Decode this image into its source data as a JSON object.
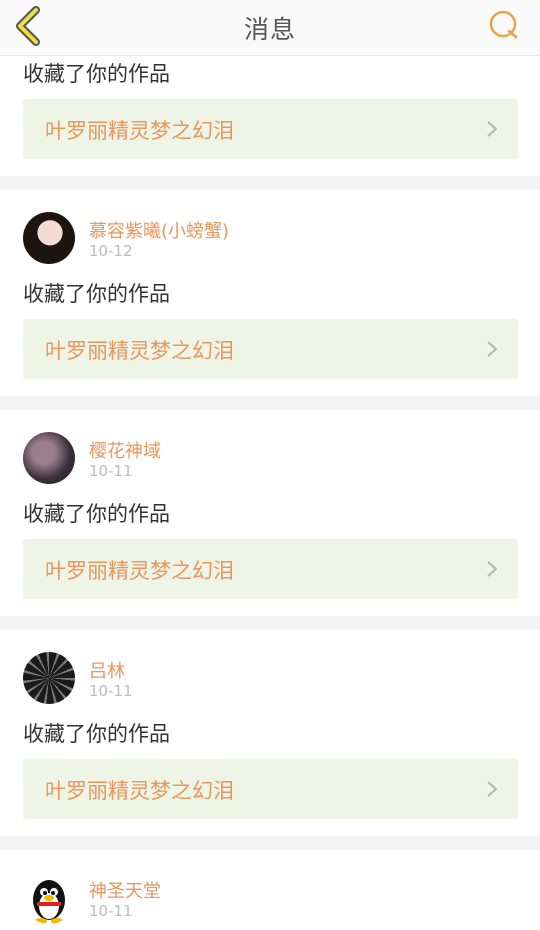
{
  "header": {
    "title": "消息",
    "accent_color": "#f0a046",
    "back_icon": "chevron-left-icon",
    "search_icon": "search-icon"
  },
  "messages": [
    {
      "action": "收藏了你的作品",
      "work": "叶罗丽精灵梦之幻泪"
    },
    {
      "user": "慕容紫曦(小螃蟹)",
      "date": "10-12",
      "action": "收藏了你的作品",
      "work": "叶罗丽精灵梦之幻泪"
    },
    {
      "user": "樱花神域",
      "date": "10-11",
      "action": "收藏了你的作品",
      "work": "叶罗丽精灵梦之幻泪"
    },
    {
      "user": "吕林",
      "date": "10-11",
      "action": "收藏了你的作品",
      "work": "叶罗丽精灵梦之幻泪"
    },
    {
      "user": "神圣天堂",
      "date": "10-11"
    }
  ],
  "colors": {
    "name": "#e8975e",
    "link_bg": "#eef4e6",
    "separator": "#f3f3f3"
  }
}
